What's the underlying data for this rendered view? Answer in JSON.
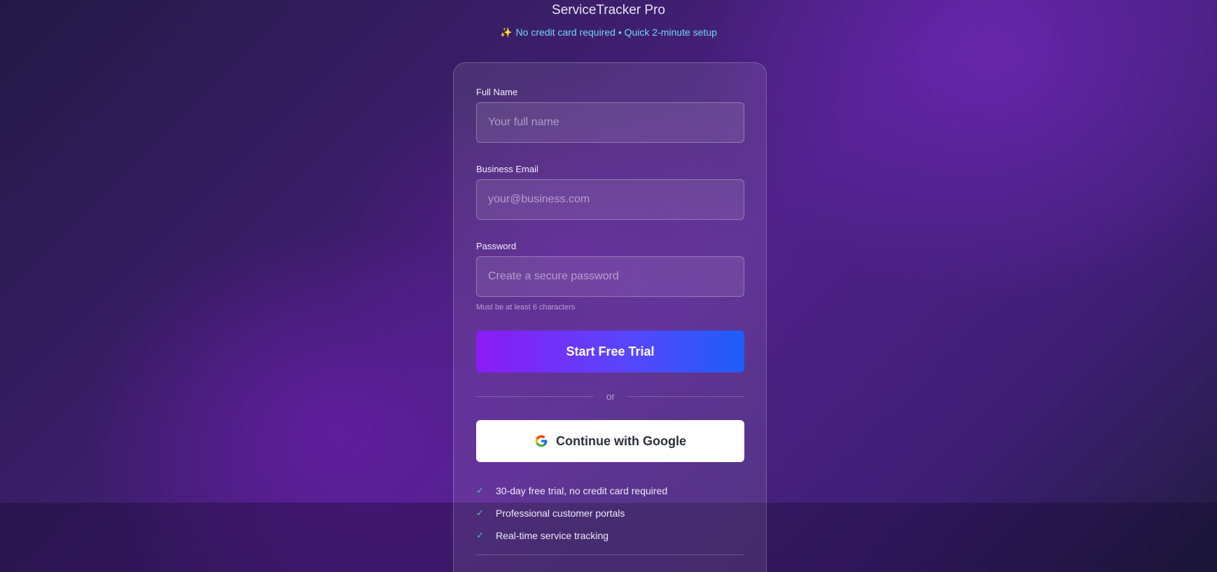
{
  "header": {
    "title": "ServiceTracker Pro",
    "tagline_icon": "sparkles-icon",
    "tagline": "No credit card required • Quick 2-minute setup"
  },
  "form": {
    "full_name": {
      "label": "Full Name",
      "placeholder": "Your full name",
      "value": ""
    },
    "email": {
      "label": "Business Email",
      "placeholder": "your@business.com",
      "value": ""
    },
    "password": {
      "label": "Password",
      "placeholder": "Create a secure password",
      "value": "",
      "hint": "Must be at least 6 characters"
    },
    "submit_label": "Start Free Trial",
    "divider_text": "or",
    "google_label": "Continue with Google"
  },
  "features": [
    {
      "icon": "check-icon",
      "text": "30-day free trial, no credit card required"
    },
    {
      "icon": "check-icon",
      "text": "Professional customer portals"
    },
    {
      "icon": "check-icon",
      "text": "Real-time service tracking"
    }
  ],
  "colors": {
    "accent_start": "#8b1bf5",
    "accent_end": "#1d5ef8",
    "tagline": "#6fd8f3",
    "check": "#2fd4a5"
  }
}
